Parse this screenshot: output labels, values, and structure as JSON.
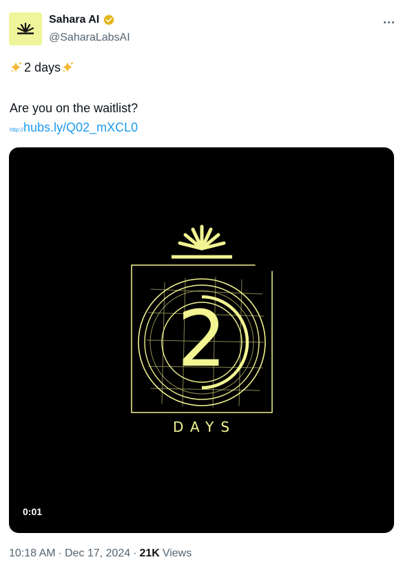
{
  "author": {
    "display_name": "Sahara AI",
    "handle": "@SaharaLabsAI",
    "verified_badge_color": "#e2b719",
    "avatar_bg": "#eef59a"
  },
  "tweet": {
    "line1_text": "2 days",
    "line2_text": "Are you on the waitlist?",
    "link_prefix": "http://",
    "link_text": "hubs.ly/Q02_mXCL0"
  },
  "media": {
    "accent_color": "#f2f591",
    "big_number": "2",
    "caption": "DAYS",
    "duration": "0:01"
  },
  "footer": {
    "time": "10:18 AM",
    "date": "Dec 17, 2024",
    "views_count": "21K",
    "views_label": "Views"
  }
}
